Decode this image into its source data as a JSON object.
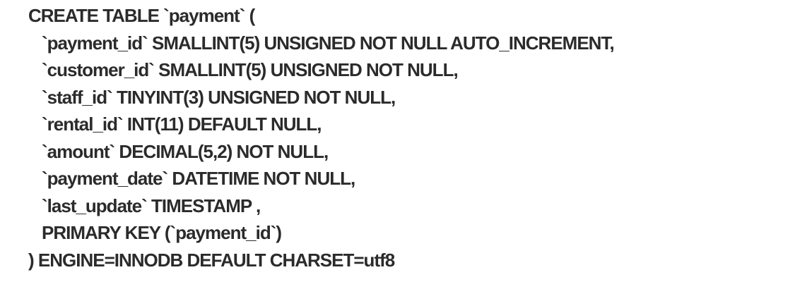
{
  "code": {
    "lines": [
      "CREATE TABLE `payment` (",
      "`payment_id` SMALLINT(5) UNSIGNED NOT NULL AUTO_INCREMENT,",
      "`customer_id` SMALLINT(5) UNSIGNED NOT NULL,",
      "`staff_id` TINYINT(3) UNSIGNED NOT NULL,",
      "`rental_id` INT(11) DEFAULT NULL,",
      "`amount` DECIMAL(5,2) NOT NULL,",
      "`payment_date` DATETIME NOT NULL,",
      "`last_update` TIMESTAMP ,",
      "PRIMARY KEY (`payment_id`)",
      ") ENGINE=INNODB DEFAULT CHARSET=utf8"
    ]
  }
}
